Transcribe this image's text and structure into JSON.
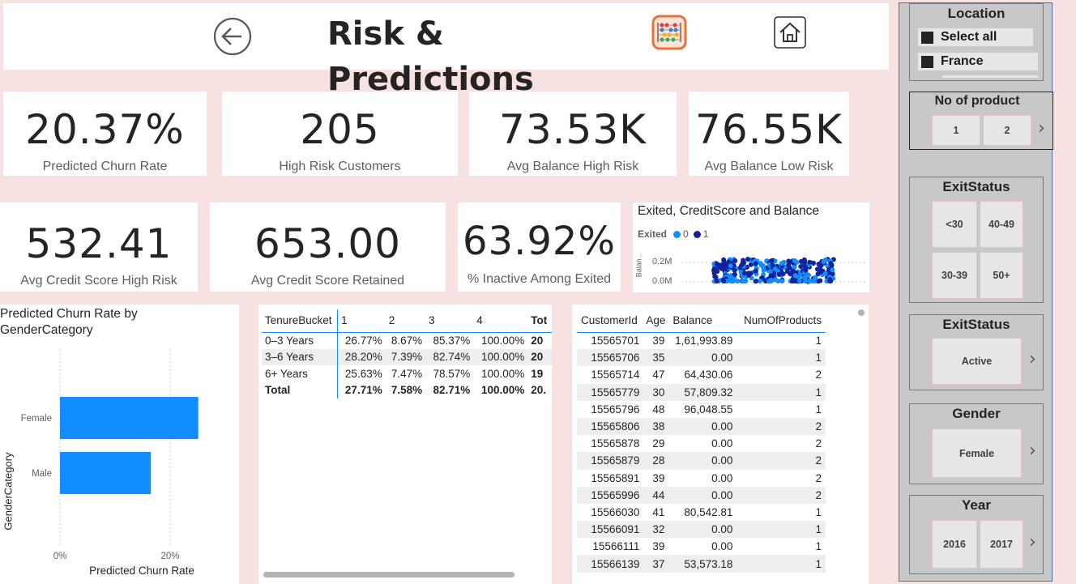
{
  "header": {
    "title": "Risk & Predictions",
    "back_icon": "back-arrow-icon",
    "abacus_icon": "abacus-icon",
    "home_icon": "home-icon"
  },
  "kpis": [
    {
      "value": "20.37%",
      "label": "Predicted Churn Rate"
    },
    {
      "value": "205",
      "label": "High Risk Customers"
    },
    {
      "value": "73.53K",
      "label": "Avg Balance High Risk"
    },
    {
      "value": "76.55K",
      "label": "Avg Balance Low Risk"
    },
    {
      "value": "532.41",
      "label": "Avg Credit Score High Risk"
    },
    {
      "value": "653.00",
      "label": "Avg Credit Score Retained"
    },
    {
      "value": "63.92%",
      "label": "% Inactive Among Exited"
    }
  ],
  "scatter": {
    "title": "Exited, CreditScore and Balance",
    "legend_title": "Exited",
    "legend_items": [
      "0",
      "1"
    ],
    "y_axis_label": "Balan...",
    "y_ticks": [
      "0.2M",
      "0.0M"
    ],
    "colors": {
      "exited_0": "#118dff",
      "exited_1": "#12239e"
    }
  },
  "chart_data": {
    "type": "bar",
    "title": "Predicted Churn Rate by GenderCategory",
    "xlabel": "Predicted Churn Rate",
    "ylabel": "GenderCategory",
    "categories": [
      "Female",
      "Male"
    ],
    "values": [
      25.1,
      16.5
    ],
    "xlim": [
      0,
      30
    ],
    "x_ticks": [
      "0%",
      "20%"
    ],
    "x_tick_values": [
      0,
      20
    ],
    "bar_color": "#118dff"
  },
  "matrix": {
    "headers": [
      "TenureBucket",
      "1",
      "2",
      "3",
      "4",
      "Tot"
    ],
    "rows": [
      [
        "0–3 Years",
        "26.77%",
        "8.67%",
        "85.37%",
        "100.00%",
        "20"
      ],
      [
        "3–6 Years",
        "28.20%",
        "7.39%",
        "82.74%",
        "100.00%",
        "20"
      ],
      [
        "6+ Years",
        "25.63%",
        "7.47%",
        "78.57%",
        "100.00%",
        "19"
      ]
    ],
    "total_row": [
      "Total",
      "27.71%",
      "7.58%",
      "82.71%",
      "100.00%",
      "20."
    ]
  },
  "customer_table": {
    "headers": [
      "CustomerId",
      "Age",
      "Balance",
      "NumOfProducts"
    ],
    "rows": [
      [
        "15565701",
        "39",
        "1,61,993.89",
        "1"
      ],
      [
        "15565706",
        "35",
        "0.00",
        "1"
      ],
      [
        "15565714",
        "47",
        "64,430.06",
        "2"
      ],
      [
        "15565779",
        "30",
        "57,809.32",
        "1"
      ],
      [
        "15565796",
        "48",
        "96,048.55",
        "1"
      ],
      [
        "15565806",
        "38",
        "0.00",
        "2"
      ],
      [
        "15565878",
        "29",
        "0.00",
        "2"
      ],
      [
        "15565879",
        "28",
        "0.00",
        "2"
      ],
      [
        "15565891",
        "39",
        "0.00",
        "2"
      ],
      [
        "15565996",
        "44",
        "0.00",
        "2"
      ],
      [
        "15566030",
        "41",
        "80,542.81",
        "1"
      ],
      [
        "15566091",
        "32",
        "0.00",
        "1"
      ],
      [
        "15566111",
        "39",
        "0.00",
        "1"
      ],
      [
        "15566139",
        "37",
        "53,573.18",
        "1"
      ]
    ]
  },
  "slicers": {
    "location": {
      "title": "Location",
      "items": [
        "Select all",
        "France"
      ]
    },
    "products": {
      "title": "No of product",
      "items": [
        "1",
        "2"
      ]
    },
    "exit_age": {
      "title": "ExitStatus",
      "items": [
        "<30",
        "40-49",
        "30-39",
        "50+"
      ]
    },
    "exit_status": {
      "title": "ExitStatus",
      "items": [
        "Active"
      ]
    },
    "gender": {
      "title": "Gender",
      "items": [
        "Female"
      ]
    },
    "year": {
      "title": "Year",
      "items": [
        "2016",
        "2017"
      ]
    }
  }
}
